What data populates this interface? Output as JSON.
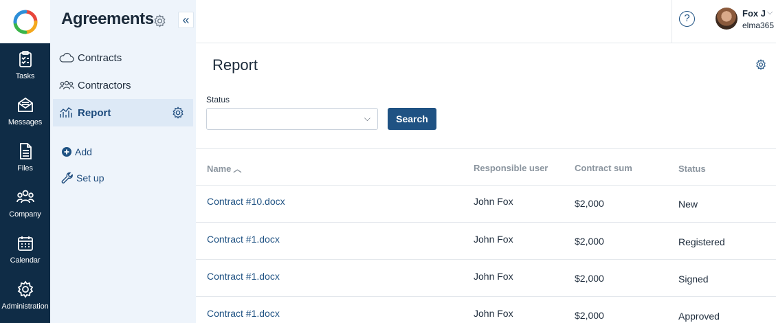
{
  "rail": {
    "items": [
      {
        "label": "Tasks",
        "icon": "tasks-icon"
      },
      {
        "label": "Messages",
        "icon": "messages-icon"
      },
      {
        "label": "Files",
        "icon": "files-icon"
      },
      {
        "label": "Company",
        "icon": "company-icon"
      },
      {
        "label": "Calendar",
        "icon": "calendar-icon"
      },
      {
        "label": "Administration",
        "icon": "gear-icon"
      }
    ]
  },
  "sidebar": {
    "title": "Agreements",
    "items": [
      {
        "label": "Contracts",
        "icon": "cloud-icon"
      },
      {
        "label": "Contractors",
        "icon": "people-icon"
      },
      {
        "label": "Report",
        "icon": "chart-icon",
        "active": true
      }
    ],
    "actions": {
      "add": "Add",
      "setup": "Set up"
    }
  },
  "header": {
    "help": "?",
    "user": {
      "name": "Fox J",
      "org": "elma365"
    }
  },
  "main": {
    "title": "Report",
    "filter": {
      "status_label": "Status",
      "status_value": "",
      "search_button": "Search"
    },
    "table": {
      "columns": [
        "Name",
        "Responsible user",
        "Contract sum",
        "Status"
      ],
      "rows": [
        {
          "name": "Contract #10.docx",
          "user": "John Fox",
          "sum": "$2,000",
          "status": "New"
        },
        {
          "name": "Contract #1.docx",
          "user": "John Fox",
          "sum": "$2,000",
          "status": "Registered"
        },
        {
          "name": "Contract #1.docx",
          "user": "John Fox",
          "sum": "$2,000",
          "status": "Signed"
        },
        {
          "name": "Contract #1.docx",
          "user": "John Fox",
          "sum": "$2,000",
          "status": "Approved"
        }
      ]
    }
  },
  "colors": {
    "rail_bg": "#0f2c46",
    "sidebar_bg": "#eef4fb",
    "accent": "#1f5283"
  }
}
